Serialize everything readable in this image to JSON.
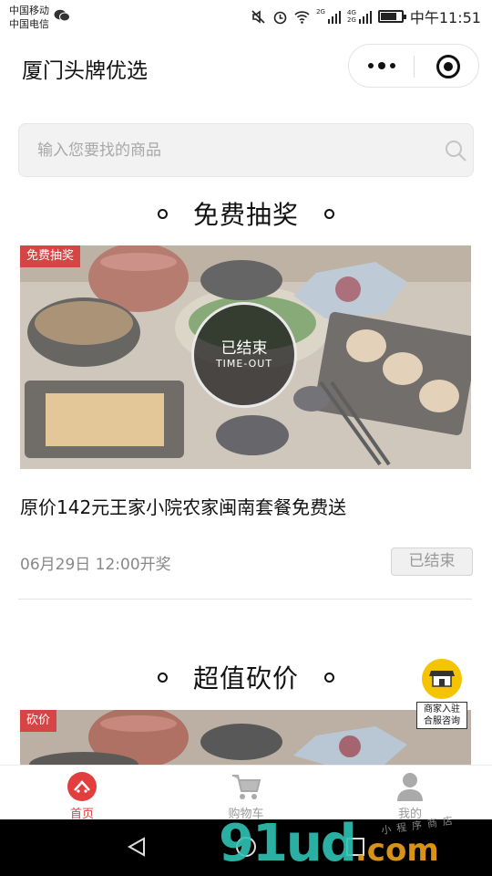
{
  "status_bar": {
    "carrier_1": "中国移动",
    "carrier_2": "中国电信",
    "net_2g": "2G",
    "net_4g": "4G",
    "net_2g_b": "2G",
    "battery_level": 0.8,
    "time": "中午11:51"
  },
  "nav": {
    "title": "厦门头牌优选"
  },
  "search": {
    "placeholder": "输入您要找的商品"
  },
  "sections": {
    "lottery": {
      "title": "免费抽奖",
      "tag": "免费抽奖",
      "ended_cn": "已结束",
      "ended_en": "TIME-OUT",
      "product_title": "原价142元王家小院农家闽南套餐免费送",
      "draw_time": "06月29日 12:00开奖",
      "status_button": "已结束"
    },
    "bargain": {
      "title": "超值砍价",
      "tag": "砍价"
    }
  },
  "merchant_float": {
    "line1": "商家入驻",
    "line2": "合服咨询"
  },
  "tabbar": {
    "items": [
      {
        "label": "首页",
        "icon": "home-icon",
        "active": true
      },
      {
        "label": "购物车",
        "icon": "cart-icon",
        "active": false
      },
      {
        "label": "我的",
        "icon": "user-icon",
        "active": false
      }
    ]
  },
  "watermark": {
    "main": "91ud",
    "suffix": ".com",
    "small": "小程序商店"
  },
  "colors": {
    "accent": "#e23e3e",
    "tag_red": "#d64545",
    "merchant_yellow": "#f5c400"
  }
}
